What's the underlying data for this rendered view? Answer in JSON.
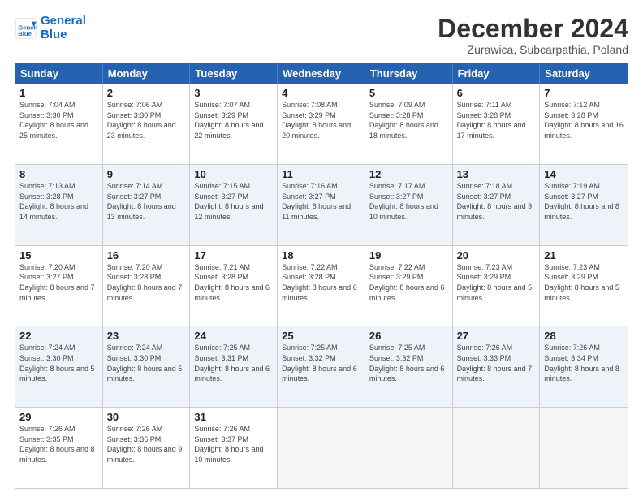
{
  "logo": {
    "line1": "General",
    "line2": "Blue"
  },
  "title": "December 2024",
  "subtitle": "Zurawica, Subcarpathia, Poland",
  "days": [
    "Sunday",
    "Monday",
    "Tuesday",
    "Wednesday",
    "Thursday",
    "Friday",
    "Saturday"
  ],
  "rows": [
    [
      {
        "day": "1",
        "rise": "Sunrise: 7:04 AM",
        "set": "Sunset: 3:30 PM",
        "light": "Daylight: 8 hours and 25 minutes."
      },
      {
        "day": "2",
        "rise": "Sunrise: 7:06 AM",
        "set": "Sunset: 3:30 PM",
        "light": "Daylight: 8 hours and 23 minutes."
      },
      {
        "day": "3",
        "rise": "Sunrise: 7:07 AM",
        "set": "Sunset: 3:29 PM",
        "light": "Daylight: 8 hours and 22 minutes."
      },
      {
        "day": "4",
        "rise": "Sunrise: 7:08 AM",
        "set": "Sunset: 3:29 PM",
        "light": "Daylight: 8 hours and 20 minutes."
      },
      {
        "day": "5",
        "rise": "Sunrise: 7:09 AM",
        "set": "Sunset: 3:28 PM",
        "light": "Daylight: 8 hours and 18 minutes."
      },
      {
        "day": "6",
        "rise": "Sunrise: 7:11 AM",
        "set": "Sunset: 3:28 PM",
        "light": "Daylight: 8 hours and 17 minutes."
      },
      {
        "day": "7",
        "rise": "Sunrise: 7:12 AM",
        "set": "Sunset: 3:28 PM",
        "light": "Daylight: 8 hours and 16 minutes."
      }
    ],
    [
      {
        "day": "8",
        "rise": "Sunrise: 7:13 AM",
        "set": "Sunset: 3:28 PM",
        "light": "Daylight: 8 hours and 14 minutes."
      },
      {
        "day": "9",
        "rise": "Sunrise: 7:14 AM",
        "set": "Sunset: 3:27 PM",
        "light": "Daylight: 8 hours and 13 minutes."
      },
      {
        "day": "10",
        "rise": "Sunrise: 7:15 AM",
        "set": "Sunset: 3:27 PM",
        "light": "Daylight: 8 hours and 12 minutes."
      },
      {
        "day": "11",
        "rise": "Sunrise: 7:16 AM",
        "set": "Sunset: 3:27 PM",
        "light": "Daylight: 8 hours and 11 minutes."
      },
      {
        "day": "12",
        "rise": "Sunrise: 7:17 AM",
        "set": "Sunset: 3:27 PM",
        "light": "Daylight: 8 hours and 10 minutes."
      },
      {
        "day": "13",
        "rise": "Sunrise: 7:18 AM",
        "set": "Sunset: 3:27 PM",
        "light": "Daylight: 8 hours and 9 minutes."
      },
      {
        "day": "14",
        "rise": "Sunrise: 7:19 AM",
        "set": "Sunset: 3:27 PM",
        "light": "Daylight: 8 hours and 8 minutes."
      }
    ],
    [
      {
        "day": "15",
        "rise": "Sunrise: 7:20 AM",
        "set": "Sunset: 3:27 PM",
        "light": "Daylight: 8 hours and 7 minutes."
      },
      {
        "day": "16",
        "rise": "Sunrise: 7:20 AM",
        "set": "Sunset: 3:28 PM",
        "light": "Daylight: 8 hours and 7 minutes."
      },
      {
        "day": "17",
        "rise": "Sunrise: 7:21 AM",
        "set": "Sunset: 3:28 PM",
        "light": "Daylight: 8 hours and 6 minutes."
      },
      {
        "day": "18",
        "rise": "Sunrise: 7:22 AM",
        "set": "Sunset: 3:28 PM",
        "light": "Daylight: 8 hours and 6 minutes."
      },
      {
        "day": "19",
        "rise": "Sunrise: 7:22 AM",
        "set": "Sunset: 3:29 PM",
        "light": "Daylight: 8 hours and 6 minutes."
      },
      {
        "day": "20",
        "rise": "Sunrise: 7:23 AM",
        "set": "Sunset: 3:29 PM",
        "light": "Daylight: 8 hours and 5 minutes."
      },
      {
        "day": "21",
        "rise": "Sunrise: 7:23 AM",
        "set": "Sunset: 3:29 PM",
        "light": "Daylight: 8 hours and 5 minutes."
      }
    ],
    [
      {
        "day": "22",
        "rise": "Sunrise: 7:24 AM",
        "set": "Sunset: 3:30 PM",
        "light": "Daylight: 8 hours and 5 minutes."
      },
      {
        "day": "23",
        "rise": "Sunrise: 7:24 AM",
        "set": "Sunset: 3:30 PM",
        "light": "Daylight: 8 hours and 5 minutes."
      },
      {
        "day": "24",
        "rise": "Sunrise: 7:25 AM",
        "set": "Sunset: 3:31 PM",
        "light": "Daylight: 8 hours and 6 minutes."
      },
      {
        "day": "25",
        "rise": "Sunrise: 7:25 AM",
        "set": "Sunset: 3:32 PM",
        "light": "Daylight: 8 hours and 6 minutes."
      },
      {
        "day": "26",
        "rise": "Sunrise: 7:25 AM",
        "set": "Sunset: 3:32 PM",
        "light": "Daylight: 8 hours and 6 minutes."
      },
      {
        "day": "27",
        "rise": "Sunrise: 7:26 AM",
        "set": "Sunset: 3:33 PM",
        "light": "Daylight: 8 hours and 7 minutes."
      },
      {
        "day": "28",
        "rise": "Sunrise: 7:26 AM",
        "set": "Sunset: 3:34 PM",
        "light": "Daylight: 8 hours and 8 minutes."
      }
    ],
    [
      {
        "day": "29",
        "rise": "Sunrise: 7:26 AM",
        "set": "Sunset: 3:35 PM",
        "light": "Daylight: 8 hours and 8 minutes."
      },
      {
        "day": "30",
        "rise": "Sunrise: 7:26 AM",
        "set": "Sunset: 3:36 PM",
        "light": "Daylight: 8 hours and 9 minutes."
      },
      {
        "day": "31",
        "rise": "Sunrise: 7:26 AM",
        "set": "Sunset: 3:37 PM",
        "light": "Daylight: 8 hours and 10 minutes."
      },
      null,
      null,
      null,
      null
    ]
  ]
}
